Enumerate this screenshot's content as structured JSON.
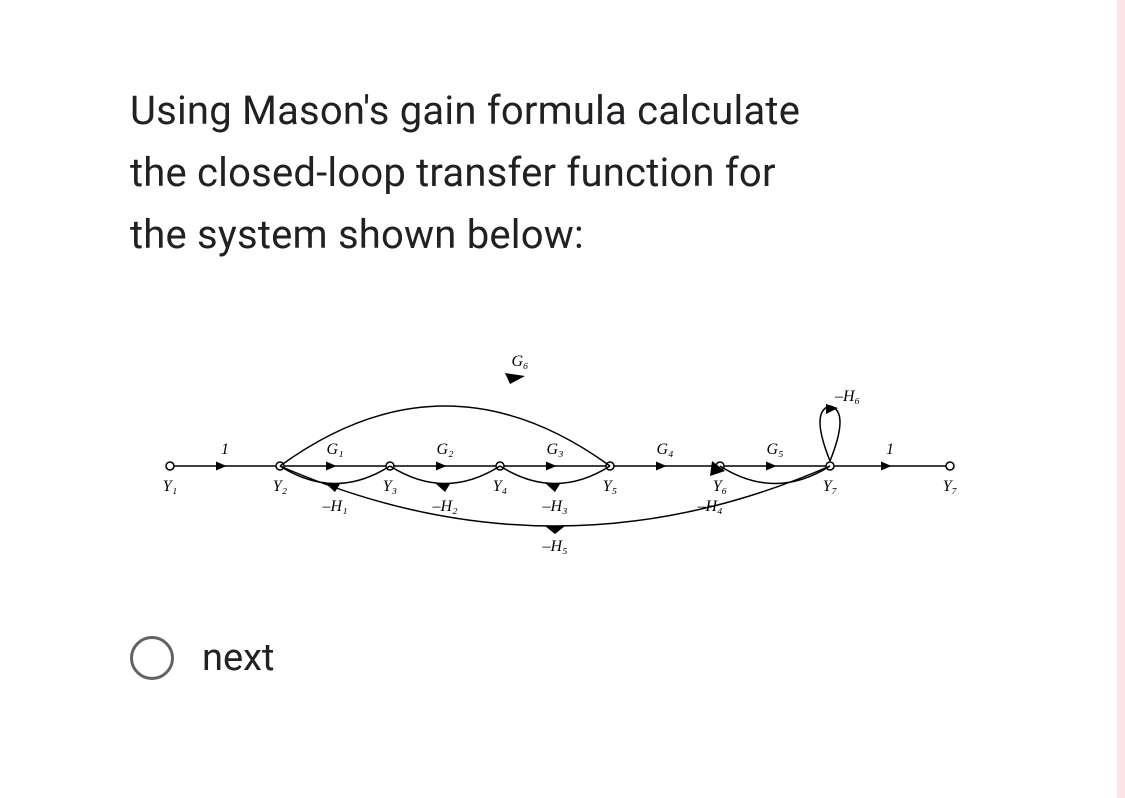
{
  "question": {
    "line1": "Using Mason's gain formula calculate",
    "line2": "the closed-loop transfer function for",
    "line3": "the system shown below:"
  },
  "diagram": {
    "nodes": {
      "y1": "Y₁",
      "y2": "Y₂",
      "y3": "Y₃",
      "y4": "Y₄",
      "y5": "Y₅",
      "y6": "Y₆",
      "y7": "Y₇",
      "y8": "Y₇"
    },
    "edges": {
      "g1": "G₁",
      "g2": "G₂",
      "g3": "G₃",
      "g4": "G₄",
      "g5": "G₅",
      "g6": "G₆",
      "h1": "–H₁",
      "h2": "–H₂",
      "h3": "–H₃",
      "h4": "–H₄",
      "h5": "–H₅",
      "h6": "–H₆",
      "one_left": "1",
      "one_right": "1"
    }
  },
  "option": {
    "label": "next"
  }
}
